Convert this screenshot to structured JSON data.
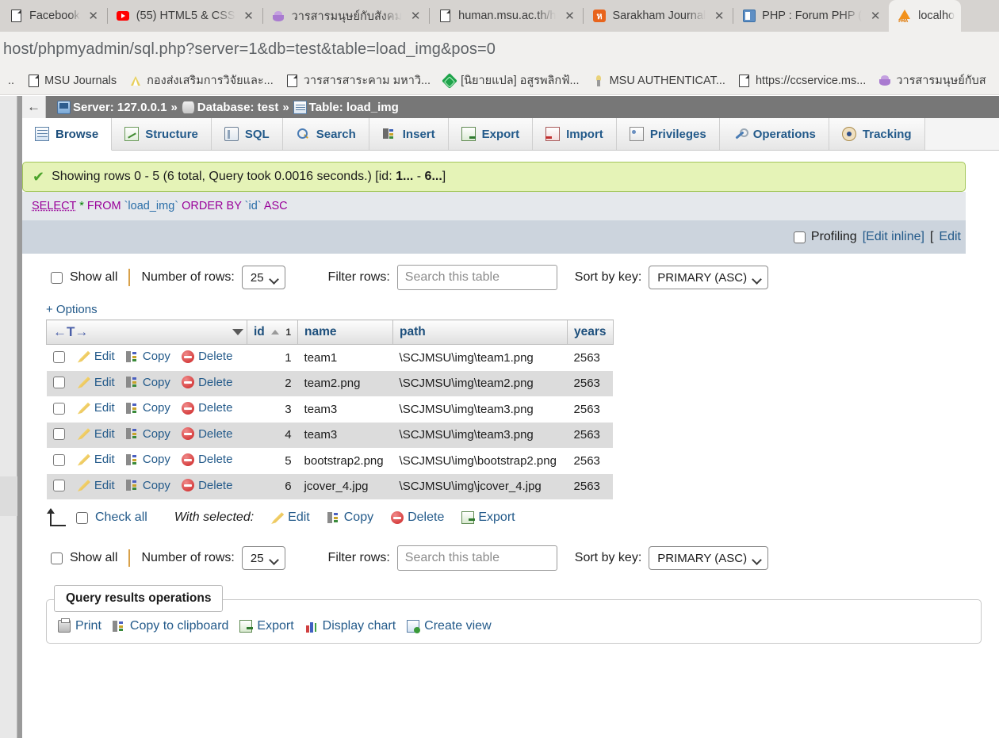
{
  "browser": {
    "tabs": [
      {
        "title": "Facebook",
        "favicon": "document-icon",
        "active": false
      },
      {
        "title": "(55) HTML5 & CSS",
        "favicon": "youtube-icon",
        "active": false
      },
      {
        "title": "วารสารมนุษย์กับสังคม",
        "favicon": "lotus-icon",
        "active": false
      },
      {
        "title": "human.msu.ac.th/h",
        "favicon": "document-icon",
        "active": false
      },
      {
        "title": "Sarakham Journal",
        "favicon": "sarakham-icon",
        "active": false
      },
      {
        "title": "PHP : Forum PHP (",
        "favicon": "php-icon",
        "active": false
      },
      {
        "title": "localho",
        "favicon": "phpmyadmin-icon",
        "active": true
      }
    ],
    "close_label": "✕",
    "address": "host/phpmyadmin/sql.php?server=1&db=test&table=load_img&pos=0",
    "bookmarks": [
      {
        "label": "MSU Journals",
        "icon": "document-icon"
      },
      {
        "label": "กองส่งเสริมการวิจัยและ...",
        "icon": "mountain-icon"
      },
      {
        "label": "วารสารสาระคาม มหาวิ...",
        "icon": "document-icon"
      },
      {
        "label": "[นิยายแปล] อสูรพลิกฟ้...",
        "icon": "green-diamond-icon"
      },
      {
        "label": "MSU AUTHENTICAT...",
        "icon": "torch-icon"
      },
      {
        "label": "https://ccservice.ms...",
        "icon": "document-icon"
      },
      {
        "label": "วารสารมนุษย์กับส",
        "icon": "lotus-icon"
      }
    ],
    "bookmark_overflow": ".."
  },
  "pma": {
    "back_arrow": "←",
    "breadcrumb": {
      "server_label": "Server: 127.0.0.1",
      "sep1": "»",
      "database_label": "Database: test",
      "sep2": "»",
      "table_label": "Table: load_img"
    },
    "tabs": [
      {
        "label": "Browse",
        "icon": "browse-icon",
        "active": true
      },
      {
        "label": "Structure",
        "icon": "structure-icon",
        "active": false
      },
      {
        "label": "SQL",
        "icon": "sql-icon",
        "active": false
      },
      {
        "label": "Search",
        "icon": "search-icon",
        "active": false
      },
      {
        "label": "Insert",
        "icon": "insert-icon",
        "active": false
      },
      {
        "label": "Export",
        "icon": "export-icon",
        "active": false
      },
      {
        "label": "Import",
        "icon": "import-icon",
        "active": false
      },
      {
        "label": "Privileges",
        "icon": "privileges-icon",
        "active": false
      },
      {
        "label": "Operations",
        "icon": "operations-icon",
        "active": false
      },
      {
        "label": "Tracking",
        "icon": "tracking-icon",
        "active": false
      }
    ],
    "result_message": {
      "prefix": "Showing rows 0 - 5 (6 total, Query took 0.0016 seconds.) [id: ",
      "first": "1...",
      "dash": " - ",
      "last": "6...",
      "suffix": "]"
    },
    "sql": {
      "select": "SELECT",
      "star": "*",
      "from": "FROM",
      "table": "`load_img`",
      "orderby": "ORDER BY",
      "column": "`id`",
      "direction": "ASC"
    },
    "sqlbar": {
      "profiling_label": "Profiling",
      "edit_inline": "[Edit inline]",
      "bracket": "[",
      "edit": "Edit"
    },
    "controls_top": {
      "show_all": "Show all",
      "number_of_rows_label": "Number of rows:",
      "number_of_rows_value": "25",
      "filter_rows_label": "Filter rows:",
      "filter_placeholder": "Search this table",
      "sort_by_key_label": "Sort by key:",
      "sort_by_key_value": "PRIMARY (ASC)"
    },
    "controls_bottom": {
      "show_all": "Show all",
      "number_of_rows_label": "Number of rows:",
      "number_of_rows_value": "25",
      "filter_rows_label": "Filter rows:",
      "filter_placeholder": "Search this table",
      "sort_by_key_label": "Sort by key:",
      "sort_by_key_value": "PRIMARY (ASC)"
    },
    "options_link": "+ Options",
    "table": {
      "columns": [
        "id",
        "name",
        "path",
        "years"
      ],
      "sorted_column": "id",
      "sort_order_marker": "1",
      "row_actions": [
        "Edit",
        "Copy",
        "Delete"
      ],
      "rows": [
        {
          "id": "1",
          "name": "team1",
          "path": "\\SCJMSU\\img\\team1.png",
          "years": "2563"
        },
        {
          "id": "2",
          "name": "team2.png",
          "path": "\\SCJMSU\\img\\team2.png",
          "years": "2563"
        },
        {
          "id": "3",
          "name": "team3",
          "path": "\\SCJMSU\\img\\team3.png",
          "years": "2563"
        },
        {
          "id": "4",
          "name": "team3",
          "path": "\\SCJMSU\\img\\team3.png",
          "years": "2563"
        },
        {
          "id": "5",
          "name": "bootstrap2.png",
          "path": "\\SCJMSU\\img\\bootstrap2.png",
          "years": "2563"
        },
        {
          "id": "6",
          "name": "jcover_4.jpg",
          "path": "\\SCJMSU\\img\\jcover_4.jpg",
          "years": "2563"
        }
      ]
    },
    "with_selected": {
      "check_all": "Check all",
      "label": "With selected:",
      "edit": "Edit",
      "copy": "Copy",
      "delete": "Delete",
      "export": "Export"
    },
    "query_results_operations": {
      "legend": "Query results operations",
      "print": "Print",
      "copy_to_clipboard": "Copy to clipboard",
      "export": "Export",
      "display_chart": "Display chart",
      "create_view": "Create view"
    }
  },
  "colors": {
    "success_bg": "#e5f3b7",
    "success_border": "#a3c65a",
    "breadcrumb_bg": "#777777",
    "link": "#235a8a",
    "sql_bg": "#e5e8ec",
    "sqlbar_bg": "#ccd4dd",
    "row_alt": "#dcdcdc"
  }
}
